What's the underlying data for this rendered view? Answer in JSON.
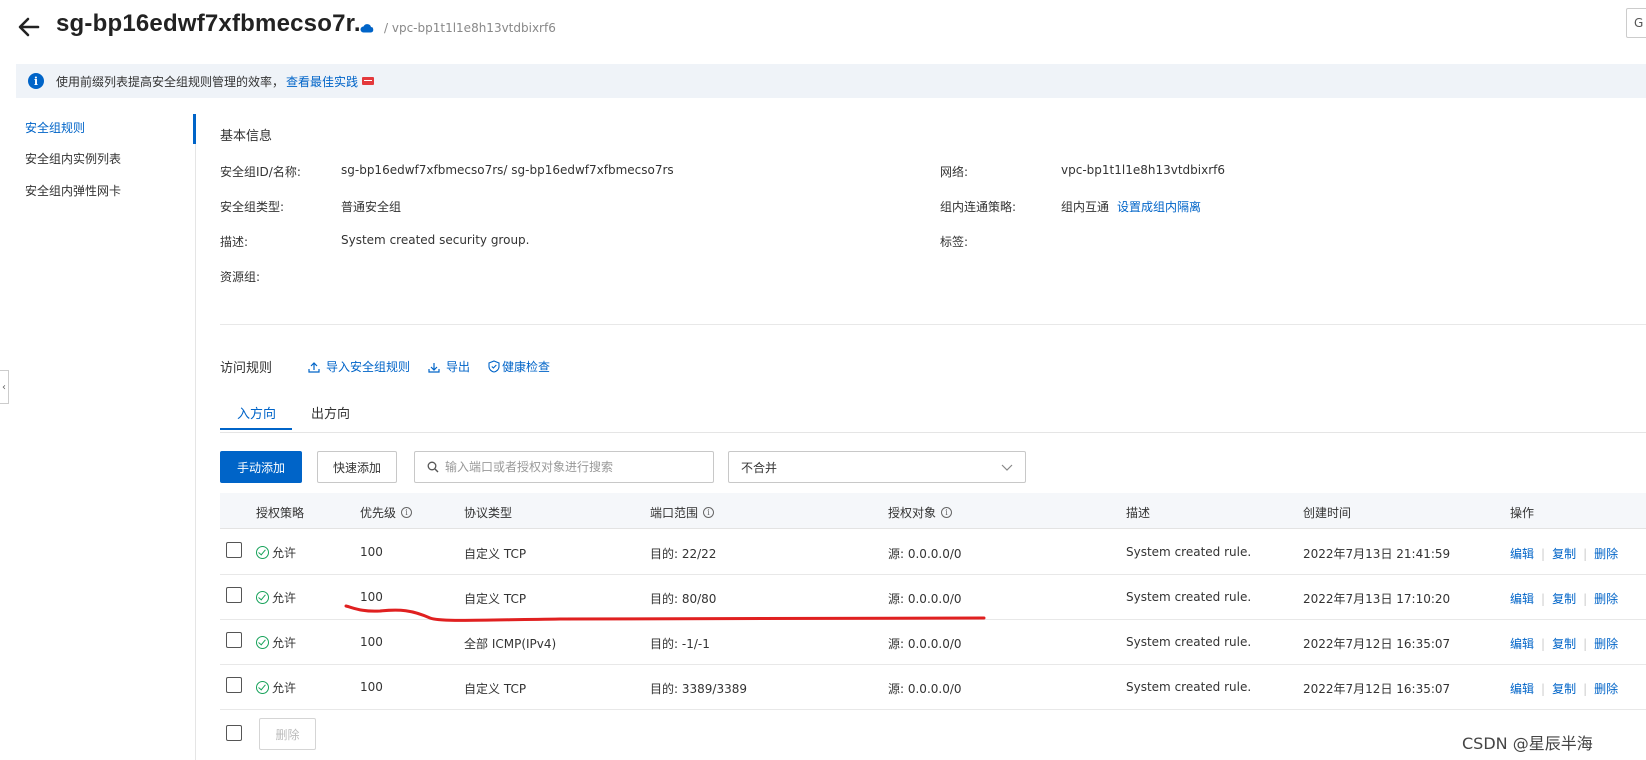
{
  "header": {
    "title": "sg-bp16edwf7xfbmecso7r...",
    "subtitle": "/ vpc-bp1t1l1e8h13vtdbixrf6",
    "top_right_button": "G"
  },
  "notice": {
    "text": "使用前缀列表提高安全组规则管理的效率，",
    "link": "查看最佳实践"
  },
  "sidenav": {
    "items": [
      {
        "label": "安全组规则"
      },
      {
        "label": "安全组内实例列表"
      },
      {
        "label": "安全组内弹性网卡"
      }
    ]
  },
  "basic_info": {
    "title": "基本信息",
    "left": [
      {
        "label": "安全组ID/名称:",
        "value": "sg-bp16edwf7xfbmecso7rs/ sg-bp16edwf7xfbmecso7rs"
      },
      {
        "label": "安全组类型:",
        "value": "普通安全组"
      },
      {
        "label": "描述:",
        "value": "System created security group."
      },
      {
        "label": "资源组:",
        "value": ""
      }
    ],
    "right": [
      {
        "label": "网络:",
        "value": "vpc-bp1t1l1e8h13vtdbixrf6"
      },
      {
        "label": "组内连通策略:",
        "value": "组内互通",
        "link": "设置成组内隔离"
      },
      {
        "label": "标签:",
        "value": ""
      }
    ]
  },
  "access_rules": {
    "title": "访问规则",
    "actions": [
      "导入安全组规则",
      "导出",
      "健康检查"
    ]
  },
  "tabs": [
    {
      "label": "入方向"
    },
    {
      "label": "出方向"
    }
  ],
  "toolbar": {
    "manual_add": "手动添加",
    "quick_add": "快速添加",
    "search_placeholder": "输入端口或者授权对象进行搜索",
    "select_value": "不合并"
  },
  "table": {
    "headers": [
      "授权策略",
      "优先级",
      "协议类型",
      "端口范围",
      "授权对象",
      "描述",
      "创建时间",
      "操作"
    ],
    "rows": [
      {
        "policy": "允许",
        "priority": "100",
        "protocol": "自定义 TCP",
        "port": "目的: 22/22",
        "target": "源: 0.0.0.0/0",
        "desc": "System created rule.",
        "created": "2022年7月13日 21:41:59"
      },
      {
        "policy": "允许",
        "priority": "100",
        "protocol": "自定义 TCP",
        "port": "目的: 80/80",
        "target": "源: 0.0.0.0/0",
        "desc": "System created rule.",
        "created": "2022年7月13日 17:10:20"
      },
      {
        "policy": "允许",
        "priority": "100",
        "protocol": "全部 ICMP(IPv4)",
        "port": "目的: -1/-1",
        "target": "源: 0.0.0.0/0",
        "desc": "System created rule.",
        "created": "2022年7月12日 16:35:07"
      },
      {
        "policy": "允许",
        "priority": "100",
        "protocol": "自定义 TCP",
        "port": "目的: 3389/3389",
        "target": "源: 0.0.0.0/0",
        "desc": "System created rule.",
        "created": "2022年7月12日 16:35:07"
      }
    ],
    "ops": [
      "编辑",
      "复制",
      "删除"
    ]
  },
  "footer": {
    "delete_button": "删除"
  },
  "watermark": "CSDN @星辰半海",
  "colors": {
    "accent": "#0064c8",
    "success": "#17a25a",
    "annotation": "#e02020"
  }
}
